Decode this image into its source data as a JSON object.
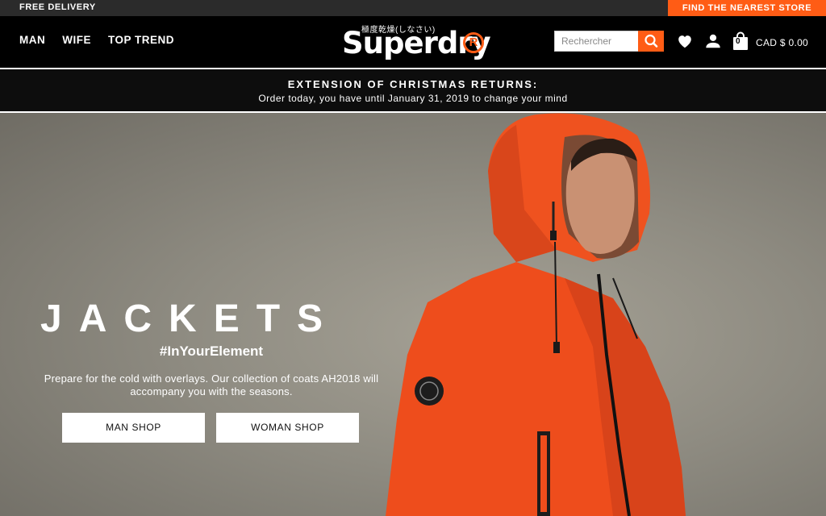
{
  "topbar": {
    "free_delivery": "FREE DELIVERY",
    "find_store": "FIND THE NEAREST STORE"
  },
  "nav": {
    "items": [
      {
        "label": "MAN"
      },
      {
        "label": "WIFE"
      },
      {
        "label": "TOP TREND"
      }
    ]
  },
  "logo": {
    "text": "Superdry",
    "japanese": "極度乾燥(しなさい)",
    "mark": "R"
  },
  "search": {
    "placeholder": "Rechercher",
    "icon": "search-icon"
  },
  "header_icons": [
    "heart-icon",
    "user-icon",
    "shopping-bag-icon"
  ],
  "cart": {
    "count": "0",
    "currency": "CAD $ 0.00"
  },
  "promo": {
    "title": "EXTENSION OF CHRISTMAS RETURNS:",
    "subtitle": "Order today, you have until January 31, 2019 to change your mind"
  },
  "hero": {
    "headline": "JACKETS",
    "hashtag": "#InYourElement",
    "description": "Prepare for the cold with overlays. Our collection of coats AH2018 will accompany you with the seasons.",
    "buttons": {
      "man": "MAN SHOP",
      "woman": "WOMAN SHOP"
    }
  },
  "colors": {
    "accent": "#ff5c15",
    "header_bg": "#000000",
    "topbar_bg": "#2b2b2b",
    "hero_bg": "#8e8b81",
    "jacket": "#f0501e"
  }
}
